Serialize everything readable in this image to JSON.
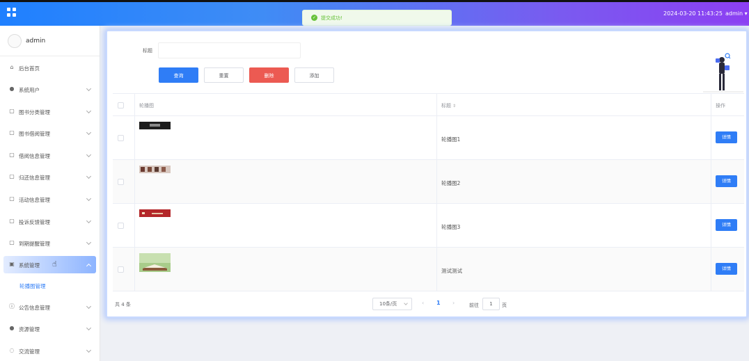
{
  "topbar": {
    "datetime": "2024-03-20 11:43:25",
    "user": "admin"
  },
  "toast": {
    "message": "提交成功!"
  },
  "sidebar": {
    "username": "admin",
    "items": [
      {
        "label": "后台首页",
        "icon": "home-icon"
      },
      {
        "label": "系统用户",
        "icon": "user-icon"
      },
      {
        "label": "图书分类管理",
        "icon": "doc-icon"
      },
      {
        "label": "图书借阅管理",
        "icon": "doc-icon"
      },
      {
        "label": "借阅信息管理",
        "icon": "doc-icon"
      },
      {
        "label": "归还信息管理",
        "icon": "doc-icon"
      },
      {
        "label": "活动信息管理",
        "icon": "doc-icon"
      },
      {
        "label": "投诉反馈管理",
        "icon": "doc-icon"
      },
      {
        "label": "到期提醒管理",
        "icon": "doc-icon"
      },
      {
        "label": "系统管理",
        "icon": "image-icon"
      },
      {
        "label": "公告信息管理",
        "icon": "info-icon"
      },
      {
        "label": "资源管理",
        "icon": "location-icon"
      },
      {
        "label": "交流管理",
        "icon": "chat-icon"
      }
    ],
    "submenu_active": "轮播图管理"
  },
  "search": {
    "label": "标题",
    "value": "",
    "placeholder": ""
  },
  "buttons": {
    "query": "查询",
    "reset": "重置",
    "delete": "删除",
    "add": "添加"
  },
  "table": {
    "headers": {
      "image": "轮播图",
      "title": "标题",
      "sort": "⇕",
      "action": "操作"
    },
    "rows": [
      {
        "title": "轮播图1",
        "action": "详情"
      },
      {
        "title": "轮播图2",
        "action": "详情"
      },
      {
        "title": "轮播图3",
        "action": "详情"
      },
      {
        "title": "测试测试",
        "action": "详情"
      }
    ]
  },
  "pagination": {
    "total": "共 4 条",
    "page_size": "10条/页",
    "prev": "‹",
    "current": "1",
    "next": "›",
    "goto_pre": "前往",
    "goto_value": "1",
    "goto_post": "页"
  }
}
